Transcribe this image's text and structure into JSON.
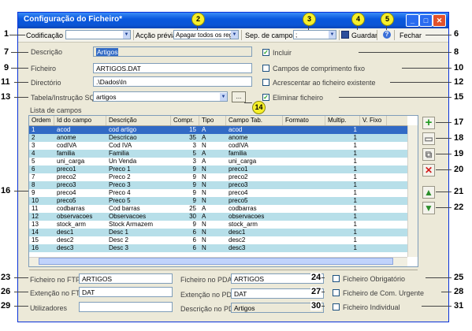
{
  "window": {
    "title": "Configuração do Ficheiro*"
  },
  "toolbar": {
    "codificacao_label": "Codificação",
    "accao_label": "Acção prévia",
    "accao_value": "Apagar todos os reg",
    "sep_label": "Sep. de campos",
    "sep_value": ";",
    "guardar_label": "Guardar",
    "fechar_label": "Fechar"
  },
  "form": {
    "descricao_label": "Descrição",
    "descricao_value": "Artigos",
    "ficheiro_label": "Ficheiro",
    "ficheiro_value": "ARTIGOS.DAT",
    "directorio_label": "Directório",
    "directorio_value": ".\\Dados\\In",
    "tabela_label": "Tabela/Instrução SQL",
    "tabela_value": "artigos",
    "browse_label": "...",
    "incluir_label": "Incluir",
    "comp_fixo_label": "Campos de comprimento fixo",
    "acrescentar_label": "Acrescentar ao ficheiro existente",
    "eliminar_label": "Eliminar ficheiro"
  },
  "grid": {
    "title": "Lista de campos",
    "columns": [
      "Ordem",
      "Id do campo",
      "Descrição",
      "Compr.",
      "Tipo",
      "Campo Tab.",
      "Formato",
      "Multip.",
      "V. Fixo"
    ],
    "rows": [
      [
        "1",
        "acod",
        "cod artigo",
        "15",
        "A",
        "acod",
        "",
        "1",
        ""
      ],
      [
        "2",
        "anome",
        "Descricao",
        "35",
        "A",
        "anome",
        "",
        "1",
        ""
      ],
      [
        "3",
        "codIVA",
        "Cod IVA",
        "3",
        "N",
        "codIVA",
        "",
        "1",
        ""
      ],
      [
        "4",
        "familia",
        "Familia",
        "5",
        "A",
        "familia",
        "",
        "1",
        ""
      ],
      [
        "5",
        "uni_carga",
        "Un Venda",
        "3",
        "A",
        "uni_carga",
        "",
        "1",
        ""
      ],
      [
        "6",
        "preco1",
        "Preco 1",
        "9",
        "N",
        "preco1",
        "",
        "1",
        ""
      ],
      [
        "7",
        "preco2",
        "Preco 2",
        "9",
        "N",
        "preco2",
        "",
        "1",
        ""
      ],
      [
        "8",
        "preco3",
        "Preco 3",
        "9",
        "N",
        "preco3",
        "",
        "1",
        ""
      ],
      [
        "9",
        "preco4",
        "Preco 4",
        "9",
        "N",
        "preco4",
        "",
        "1",
        ""
      ],
      [
        "10",
        "preco5",
        "Preco 5",
        "9",
        "N",
        "preco5",
        "",
        "1",
        ""
      ],
      [
        "11",
        "codbarras",
        "Cod barras",
        "25",
        "A",
        "codbarras",
        "",
        "1",
        ""
      ],
      [
        "12",
        "observacoes",
        "Observacoes",
        "30",
        "A",
        "observacoes",
        "",
        "1",
        ""
      ],
      [
        "13",
        "stock_arm",
        "Stock Armazem",
        "9",
        "N",
        "stock_arm",
        "",
        "1",
        ""
      ],
      [
        "14",
        "desc1",
        "Desc 1",
        "6",
        "N",
        "desc1",
        "",
        "1",
        ""
      ],
      [
        "15",
        "desc2",
        "Desc 2",
        "6",
        "N",
        "desc2",
        "",
        "1",
        ""
      ],
      [
        "16",
        "desc3",
        "Desc 3",
        "6",
        "N",
        "desc3",
        "",
        "1",
        ""
      ]
    ]
  },
  "bottom": {
    "ftp_label": "Ficheiro no FTP",
    "ftp_value": "ARTIGOS",
    "ext_ftp_label": "Extenção no FTP",
    "ext_ftp_value": "DAT",
    "util_label": "Utilizadores",
    "util_value": "",
    "pda_label": "Ficheiro no PDA",
    "pda_value": "ARTIGOS",
    "ext_pda_label": "Extenção no PDA",
    "ext_pda_value": "DAT",
    "desc_pda_label": "Descrição no PDA",
    "desc_pda_value": "Artigos",
    "obrig_label": "Ficheiro Obrigatório",
    "urgente_label": "Ficheiro de Com. Urgente",
    "individual_label": "Ficheiro Individual"
  },
  "callouts": [
    "1",
    "2",
    "3",
    "4",
    "5",
    "6",
    "7",
    "8",
    "9",
    "10",
    "11",
    "12",
    "13",
    "14",
    "15",
    "16",
    "17",
    "18",
    "19",
    "20",
    "21",
    "22",
    "23",
    "24",
    "25",
    "26",
    "27",
    "28",
    "29",
    "30",
    "31"
  ],
  "colors": {
    "titlebar": "#0a58de",
    "row_alt": "#b7dfe9",
    "selected_row": "#316ac5",
    "badge": "#f7f02a"
  }
}
